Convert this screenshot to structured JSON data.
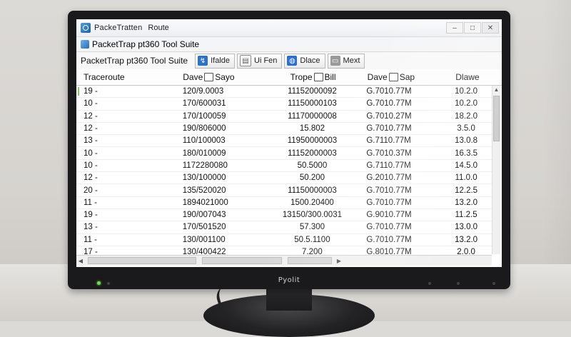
{
  "window": {
    "title": "PackeTratten",
    "title_sub": "Route",
    "controls": [
      "–",
      "□",
      "✕"
    ]
  },
  "menubar": {
    "text": "PacketTrap pt360 Tool Suite"
  },
  "toolbar": {
    "label": "PacketTrap pt360 Tool Suite",
    "buttons": [
      {
        "label": "Ifalde",
        "icon": "route-icon",
        "color": "#2a73c9"
      },
      {
        "label": "Ui Fen",
        "icon": "document-icon",
        "color": "#888888"
      },
      {
        "label": "Dlace",
        "icon": "globe-icon",
        "color": "#2d6fcf"
      },
      {
        "label": "Mext",
        "icon": "monitor-icon",
        "color": "#7a7a7a"
      }
    ]
  },
  "table": {
    "columns": [
      "Traceroute",
      "Dave",
      "Trope",
      "Dave",
      "Dlawe"
    ],
    "column_suffix": [
      "",
      "Sayo",
      "Bill",
      "Sap",
      ""
    ],
    "rows": [
      [
        "19 -",
        "120/9.0003",
        "11152000092",
        "G.7010.77M",
        "10.2.0"
      ],
      [
        "10 -",
        "170/600031",
        "11150000103",
        "G.7010.77M",
        "10.2.0"
      ],
      [
        "12 -",
        "170/100059",
        "11170000008",
        "G.7010.27M",
        "18.2.0"
      ],
      [
        "12 -",
        "190/806000",
        "15.802",
        "G.7010.77M",
        "3.5.0"
      ],
      [
        "13 -",
        "110/100003",
        "11950000003",
        "G.7110.77M",
        "13.0.8"
      ],
      [
        "10 -",
        "180/010009",
        "11152000003",
        "G.7010.37M",
        "16.3.5"
      ],
      [
        "10 -",
        "1172280080",
        "50.5000",
        "G.7110.77M",
        "14.5.0"
      ],
      [
        "12 -",
        "130/100000",
        "50.200",
        "G.2010.77M",
        "11.0.0"
      ],
      [
        "20 -",
        "135/520020",
        "11150000003",
        "G.7010.77M",
        "12.2.5"
      ],
      [
        "11 -",
        "1894021000",
        "1500.20400",
        "G.7010.77M",
        "13.2.0"
      ],
      [
        "19 -",
        "190/007043",
        "13150/300.0031",
        "G.9010.77M",
        "11.2.5"
      ],
      [
        "13 -",
        "170/501520",
        "57.300",
        "G.7010.77M",
        "13.0.0"
      ],
      [
        "11 -",
        "130/001100",
        "50.5.1100",
        "G.7010.77M",
        "13.2.0"
      ],
      [
        "17 -",
        "130/400422",
        "7.200",
        "G.8010.77M",
        "2.0.0"
      ]
    ]
  },
  "monitor": {
    "brand": "Pyolit"
  }
}
